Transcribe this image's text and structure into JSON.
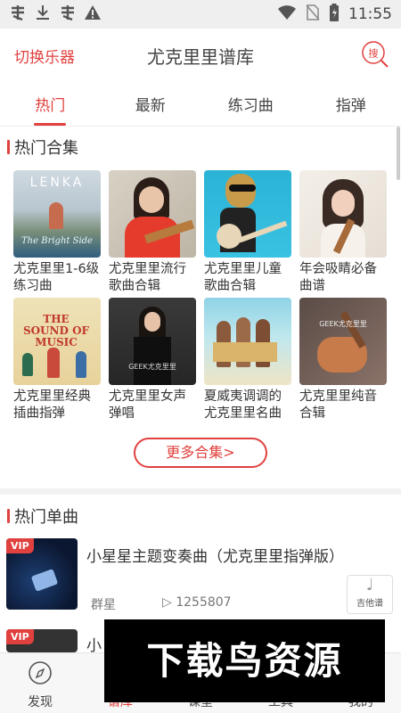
{
  "status_bar": {
    "left_icons": [
      "notification-icon",
      "download-icon",
      "notification-icon",
      "warning-icon"
    ],
    "right_icons": [
      "wifi-icon",
      "no-sim-icon",
      "battery-icon"
    ],
    "time": "11:55"
  },
  "header": {
    "switch_label": "切换乐器",
    "title": "尤克里里谱库",
    "search_icon_text": "搜"
  },
  "tabs": [
    {
      "label": "热门",
      "active": true
    },
    {
      "label": "最新",
      "active": false
    },
    {
      "label": "练习曲",
      "active": false
    },
    {
      "label": "指弹",
      "active": false
    }
  ],
  "collections": {
    "title": "热门合集",
    "items": [
      {
        "name": "尤克里里1-6级练习曲",
        "cover_text": "LENKA",
        "cover_subtext": "The Bright Side"
      },
      {
        "name": "尤克里里流行歌曲合辑",
        "cover_text": "",
        "cover_subtext": ""
      },
      {
        "name": "尤克里里儿童歌曲合辑",
        "cover_text": "",
        "cover_subtext": ""
      },
      {
        "name": "年会吸睛必备曲谱",
        "cover_text": "",
        "cover_subtext": ""
      },
      {
        "name": "尤克里里经典插曲指弹",
        "cover_text": "THE SOUND OF MUSIC",
        "cover_subtext": ""
      },
      {
        "name": "尤克里里女声弹唱",
        "cover_text": "GEEK尤克里里",
        "cover_subtext": ""
      },
      {
        "name": "夏威夷调调的尤克里里名曲",
        "cover_text": "",
        "cover_subtext": ""
      },
      {
        "name": "尤克里里纯音合辑",
        "cover_text": "GEEK尤克里里",
        "cover_subtext": ""
      }
    ],
    "more_label": "更多合集>"
  },
  "singles": {
    "title": "热门单曲",
    "items": [
      {
        "title": "小星星主题变奏曲（尤克里里指弹版）",
        "artist": "群星",
        "plays": "1255807",
        "tag": "吉他谱",
        "vip": "VIP"
      },
      {
        "title": "小",
        "artist": "",
        "plays": "",
        "tag": "",
        "vip": "VIP"
      }
    ]
  },
  "bottom_nav": [
    {
      "label": "发现",
      "icon": "compass-icon",
      "active": false
    },
    {
      "label": "谱库",
      "icon": "library-icon",
      "active": true
    },
    {
      "label": "课堂",
      "icon": "classroom-icon",
      "active": false
    },
    {
      "label": "工具",
      "icon": "tools-icon",
      "active": false
    },
    {
      "label": "我的",
      "icon": "profile-icon",
      "active": false
    }
  ],
  "watermark": "下载鸟资源",
  "colors": {
    "accent": "#e0413e",
    "text": "#333333",
    "status_bar": "#efefef"
  }
}
